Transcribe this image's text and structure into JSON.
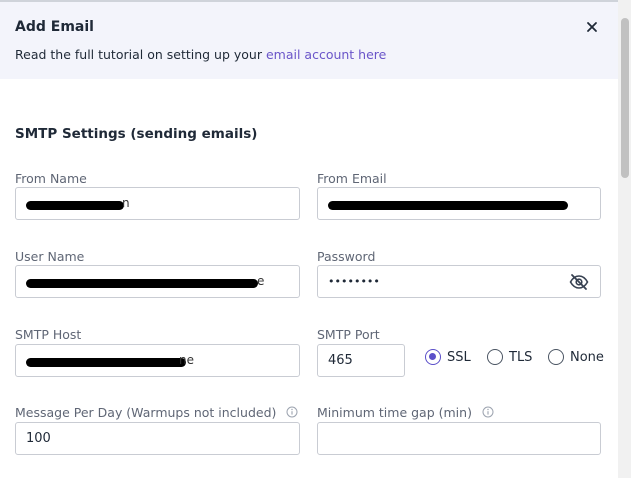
{
  "modal": {
    "title": "Add Email",
    "subtitle_prefix": "Read the full tutorial on setting up your ",
    "subtitle_link": "email account here",
    "close_icon": "close-icon"
  },
  "smtp": {
    "section_title": "SMTP Settings (sending emails)",
    "from_name": {
      "label": "From Name",
      "visible_suffix": "n"
    },
    "from_email": {
      "label": "From Email"
    },
    "user_name": {
      "label": "User Name",
      "visible_suffix": "e"
    },
    "password": {
      "label": "Password",
      "value": "••••••••",
      "toggle_icon": "eye-off-icon"
    },
    "smtp_host": {
      "label": "SMTP Host",
      "visible_suffix": "ne"
    },
    "smtp_port": {
      "label": "SMTP Port",
      "value": "465"
    },
    "security": {
      "options": [
        "SSL",
        "TLS",
        "None"
      ],
      "selected": "SSL"
    },
    "message_per_day": {
      "label": "Message Per Day (Warmups not included)",
      "value": "100",
      "info_icon": "info-icon"
    },
    "min_time_gap": {
      "label": "Minimum time gap (min)",
      "value": "",
      "info_icon": "info-icon"
    }
  },
  "colors": {
    "accent": "#5b4fc9",
    "link": "#6a55c9",
    "header_bg": "#f3f4fb"
  }
}
